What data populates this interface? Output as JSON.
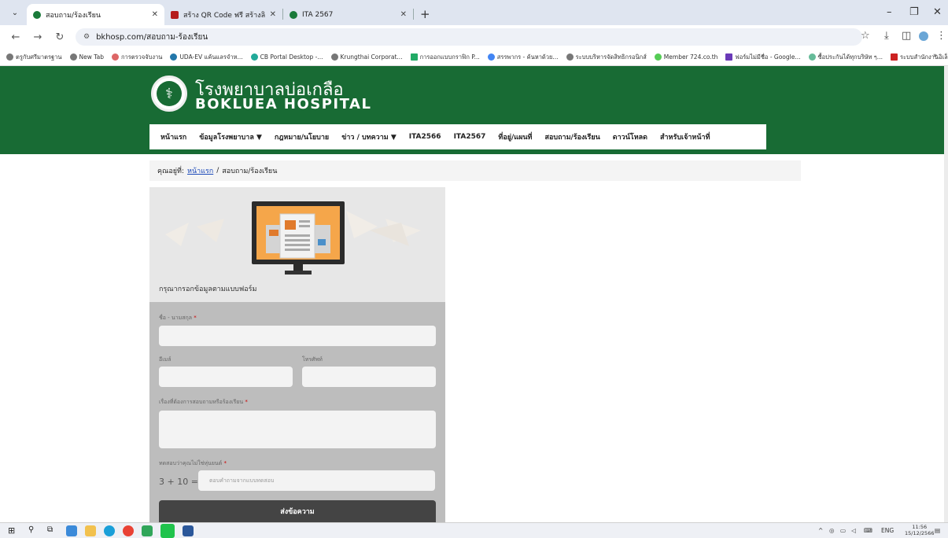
{
  "browser": {
    "tabs": [
      {
        "title": "สอบถาม/ร้องเรียน",
        "active": true
      },
      {
        "title": "สร้าง QR Code ฟรี สร้างลิงก์ได้ไม...",
        "active": false
      },
      {
        "title": "ITA 2567",
        "active": false
      }
    ],
    "url": "bkhosp.com/สอบถาม-ร้องเรียน",
    "bookmarks": [
      "ตรูกับศรีมาตรฐาน",
      "New Tab",
      "การตรวจจับงาน",
      "UDA-EV แค้นแลรจำห...",
      "CB Portal Desktop -...",
      "Krungthai Corporat...",
      "การออกแบบกราฟิก P...",
      "สรรพากร - ค้นหาด้วย...",
      "ระบบบริหารจัดสิทธิกรอนิกส์",
      "Member 724.co.th",
      "ฟอร์มไม่มีชื่อ - Google...",
      "ซื้อประกันได้ทุกบริษัท ๆ...",
      "ระบบสำนักงานอิเล็กทร..."
    ],
    "more_bookmarks": "»"
  },
  "site": {
    "name_th": "โรงพยาบาลบ่อเกลือ",
    "name_en": "BOKLUEA HOSPITAL",
    "menu": [
      "หน้าแรก",
      "ข้อมูลโรงพยาบาล ▼",
      "กฎหมาย/นโยบาย",
      "ข่าว / บทความ ▼",
      "ITA2566",
      "ITA2567",
      "ที่อยู่/แผนที่",
      "สอบถาม/ร้องเรียน",
      "ดาวน์โหลด",
      "สำหรับเจ้าหน้าที่"
    ]
  },
  "breadcrumb": {
    "prefix": "คุณอยู่ที่:",
    "home": "หน้าแรก",
    "sep": "/",
    "current": "สอบถาม/ร้องเรียน"
  },
  "form": {
    "intro": "กรุณากรอกข้อมูลตามแบบฟอร์ม",
    "name_label": "ชื่อ - นามสกุล",
    "email_label": "อีเมล์",
    "phone_label": "โทรศัพท์",
    "subject_label": "เรื่องที่ต้องการสอบถามหรือร้องเรียน",
    "captcha_label": "ทดสอบว่าคุณไม่ใช่หุ่นยนต์",
    "required_mark": "*",
    "captcha_question": "3 + 10 =",
    "captcha_placeholder": "ตอบคำถามจากแบบทดสอบ",
    "submit": "ส่งข้อความ"
  },
  "taskbar": {
    "lang": "ENG",
    "time": "11:56",
    "date": "15/12/2566"
  }
}
